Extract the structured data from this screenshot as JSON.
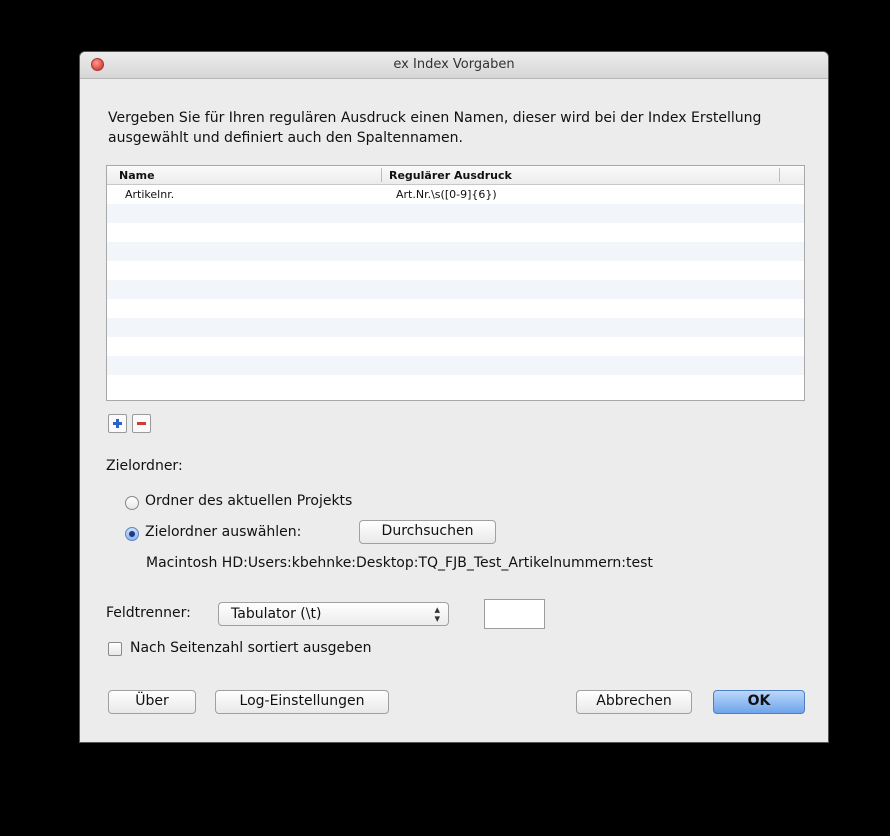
{
  "window": {
    "title": "ex Index Vorgaben"
  },
  "description": "Vergeben Sie für Ihren regulären Ausdruck einen Namen, dieser wird bei der Index Erstellung ausgewählt und definiert auch den Spaltennamen.",
  "table": {
    "columns": [
      "Name",
      "Regulärer Ausdruck"
    ],
    "rows": [
      {
        "name": "Artikelnr.",
        "regex": "Art.Nr.\\s([0-9]{6})"
      }
    ]
  },
  "icons": {
    "add": "plus-icon",
    "remove": "minus-icon"
  },
  "target": {
    "heading": "Zielordner:",
    "option_project": "Ordner des aktuellen Projekts",
    "option_select": "Zielordner auswählen:",
    "selected": "select",
    "browse_label": "Durchsuchen",
    "path": "Macintosh HD:Users:kbehnke:Desktop:TQ_FJB_Test_Artikelnummern:test"
  },
  "separator": {
    "label": "Feldtrenner:",
    "value": "Tabulator (\\t)",
    "custom_value": ""
  },
  "sort_checkbox": {
    "label": "Nach Seitenzahl sortiert ausgeben",
    "checked": false
  },
  "buttons": {
    "about": "Über",
    "log": "Log-Einstellungen",
    "cancel": "Abbrechen",
    "ok": "OK"
  },
  "colors": {
    "accent": "#6ea4ea",
    "close": "#d8453c",
    "add": "#2b63c9",
    "remove": "#d23a3a"
  }
}
